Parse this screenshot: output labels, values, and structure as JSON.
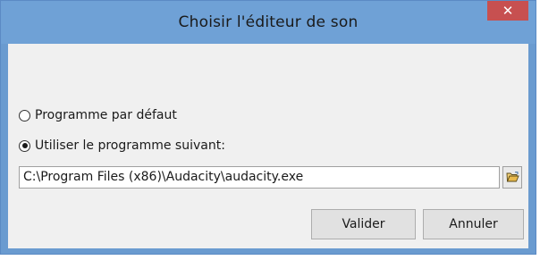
{
  "window": {
    "title": "Choisir l'éditeur de son",
    "close_label": "✕"
  },
  "options": {
    "default_label": "Programme par défaut",
    "default_selected": false,
    "custom_label": "Utiliser le programme suivant:",
    "custom_selected": true
  },
  "program_path": {
    "value": "C:\\Program Files (x86)\\Audacity\\audacity.exe",
    "browse_icon": "folder-open-icon"
  },
  "buttons": {
    "ok_label": "Valider",
    "cancel_label": "Annuler"
  },
  "colors": {
    "titlebar": "#6fa1d6",
    "close_button": "#c75050",
    "client_background": "#f0f0f0"
  }
}
